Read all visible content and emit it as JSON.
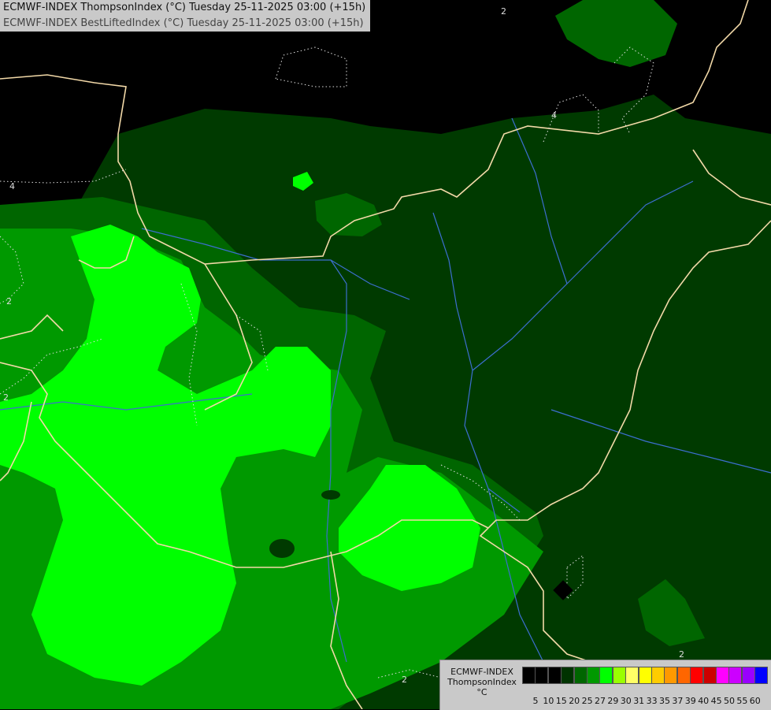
{
  "header": {
    "line1": "ECMWF-INDEX ThompsonIndex (°C) Tuesday 25-11-2025 03:00 (+15h)",
    "line2": "ECMWF-INDEX BestLiftedIndex (°C) Tuesday 25-11-2025 03:00 (+15h)"
  },
  "legend": {
    "line1": "ECMWF-INDEX",
    "line2": "ThompsonIndex",
    "line3": "°C",
    "bins": [
      {
        "label": "5",
        "color": "#000000"
      },
      {
        "label": "10",
        "color": "#000000"
      },
      {
        "label": "15",
        "color": "#000000"
      },
      {
        "label": "20",
        "color": "#003300"
      },
      {
        "label": "25",
        "color": "#006600"
      },
      {
        "label": "27",
        "color": "#009900"
      },
      {
        "label": "29",
        "color": "#00ff00"
      },
      {
        "label": "30",
        "color": "#99ff00"
      },
      {
        "label": "31",
        "color": "#ffff66"
      },
      {
        "label": "33",
        "color": "#ffff00"
      },
      {
        "label": "35",
        "color": "#ffcc00"
      },
      {
        "label": "37",
        "color": "#ff9900"
      },
      {
        "label": "39",
        "color": "#ff6600"
      },
      {
        "label": "40",
        "color": "#ff0000"
      },
      {
        "label": "45",
        "color": "#cc0000"
      },
      {
        "label": "50",
        "color": "#ff00ff"
      },
      {
        "label": "55",
        "color": "#cc00ff"
      },
      {
        "label": "60",
        "color": "#9900ff"
      },
      {
        "label": "",
        "color": "#0000ff"
      }
    ]
  },
  "contour_labels": [
    "2",
    "4",
    "4",
    "2",
    "2",
    "2",
    "2"
  ],
  "colors": {
    "background": "#000000",
    "level_20": "#003300",
    "level_25": "#006600",
    "level_27": "#009900",
    "level_29": "#00ff00",
    "borders": "#f2d9a8",
    "rivers": "#3c6ecf"
  }
}
